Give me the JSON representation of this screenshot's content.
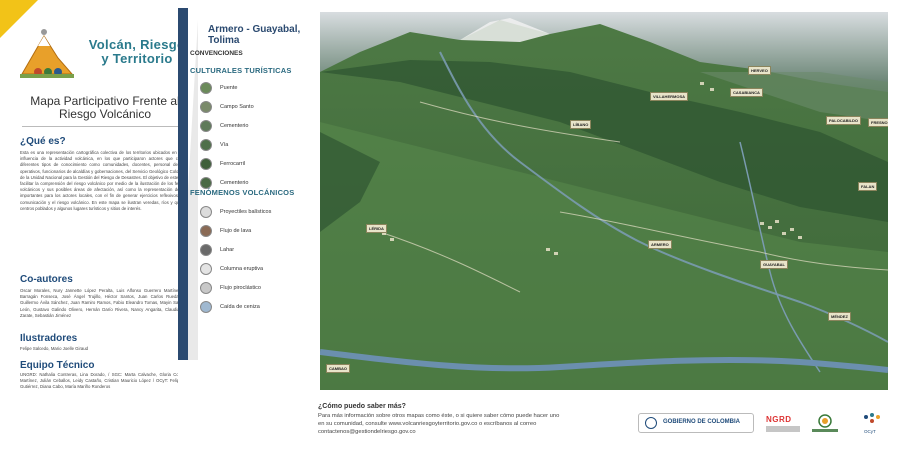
{
  "brand": {
    "title_line1": "Volcán, Riesgo",
    "title_line2": "y Territorio"
  },
  "main_title": {
    "line1": "Mapa Participativo Frente al",
    "line2": "Riesgo Volcánico"
  },
  "que_es": {
    "heading": "¿Qué es?",
    "text": "Esta es una representación cartográfica colectiva de los territorios ubicados en áreas de influencia de la actividad volcánica, en los que participaron actores que comparten diferentes tipos de conocimiento como comunidades, docentes, personal de cuerpos operativos, funcionarios de alcaldías y gobernaciones, del Servicio Geológico Colombiano y de la Unidad Nacional para la Gestión del Riesgo de Desastres. El objetivo de este mapa es facilitar la comprensión del riesgo volcánico por medio de la ilustración de los fenómenos volcánicos y sus posibles áreas de afectación, así como la representación de lugares importantes para los actores locales, con el fin de generar ejercicios reflexivos sobre la comunicación y el riesgo volcánico. En este mapa se ilustran veredas, ríos y quebradas, centros poblados y algunos lugares turísticos y sitios de interés."
  },
  "coautores": {
    "heading": "Co-autores",
    "text": "Oscar Morales, Nury Jannette López Peralta, Luis Alfonso Guerrero Martínez, Judith Barragán Fonseca, José Ángel Trujillo, Héctor Santos, Juan Carlos Rueda García, Guillermo Ávila Sánchez, Juan Ramiro Ramos, Fabio Eleandro Tomas, Mayin Sanjur, Ciro León, Gustavo Galindo Olivero, Hernán Darío Rivera, Nancy Angarita, Claudia Hernán Zarate, Sebastián Jiménez"
  },
  "ilustradores": {
    "heading": "Ilustradores",
    "text": "Felipe Salcedo, Mario Joelle Giraud"
  },
  "equipo": {
    "heading": "Equipo Técnico",
    "text": "UNGRD: Nathalia Contreras, Lina Dorado, / SGC: Marta Calvache, Gloria Cortés, Lily Martínez, Julián Ceballos, Leidy Castaño, Cristian Mauricio López / OCyT: Felipe Rocha Gutiérrez, Diana Cabo, María Mariño Ronderos"
  },
  "legend": {
    "location": "Armero - Guayabal, Tolima",
    "convenciones": "CONVENCIONES",
    "cultural_heading": "CULTURALES TURÍSTICAS",
    "cultural_items": [
      {
        "label": "Puente",
        "icon": "bridge-icon",
        "color": "#6b8a5a"
      },
      {
        "label": "Campo Santo",
        "icon": "cemetery-icon",
        "color": "#7a8a6a"
      },
      {
        "label": "Cementerio",
        "icon": "cemetery-icon",
        "color": "#5f7a5a"
      },
      {
        "label": "Vía",
        "icon": "road-icon",
        "color": "#4f6f4a"
      },
      {
        "label": "Ferrocarril",
        "icon": "railway-icon",
        "color": "#3f5f3a"
      },
      {
        "label": "Cementerio",
        "icon": "cemetery-icon",
        "color": "#4a6a45"
      }
    ],
    "volcanic_heading": "FENÓMENOS VOLCÁNICOS",
    "volcanic_items": [
      {
        "label": "Proyectiles balísticos",
        "icon": "ballistic-icon",
        "color": "#dcdcdc"
      },
      {
        "label": "Flujo de lava",
        "icon": "lava-icon",
        "color": "#8a6a55"
      },
      {
        "label": "Lahar",
        "icon": "lahar-icon",
        "color": "#6a6a6a"
      },
      {
        "label": "Columna eruptiva",
        "icon": "eruption-column-icon",
        "color": "#e4e4e4"
      },
      {
        "label": "Flujo piroclástico",
        "icon": "pyroclastic-icon",
        "color": "#c8c8c8"
      },
      {
        "label": "Caída de ceniza",
        "icon": "ash-fall-icon",
        "color": "#9fb8d0"
      }
    ]
  },
  "map": {
    "places": [
      {
        "label": "HERVEO"
      },
      {
        "label": "VILLAHERMOSA"
      },
      {
        "label": "CASABIANCA"
      },
      {
        "label": "LÍBANO"
      },
      {
        "label": "PALOCABILDO"
      },
      {
        "label": "FRESNO"
      },
      {
        "label": "FALAN"
      },
      {
        "label": "LÉRIDA"
      },
      {
        "label": "ARMERO"
      },
      {
        "label": "GUAYABAL"
      },
      {
        "label": "MÉNDEZ"
      },
      {
        "label": "CAMBAO"
      }
    ]
  },
  "info": {
    "heading": "¿Cómo puedo saber más?",
    "line1": "Para más información sobre  otros mapas como éste, o si quiere saber cómo puede hacer uno",
    "line2": "en su comunidad, consulte www.volcanriesgoyterritorio.gov.co o escríbanos al correo",
    "line3": "contactenos@gestiondelriesgo.gov.co"
  },
  "logos": {
    "gov": "GOBIERNO DE COLOMBIA",
    "ngrd": "NGRD",
    "ocyt": "OCyT"
  },
  "colors": {
    "brand_teal": "#2a7a8c",
    "heading_blue": "#1f4b7a",
    "legend_bar": "#2b4a70",
    "accent_yellow": "#f2c318"
  }
}
